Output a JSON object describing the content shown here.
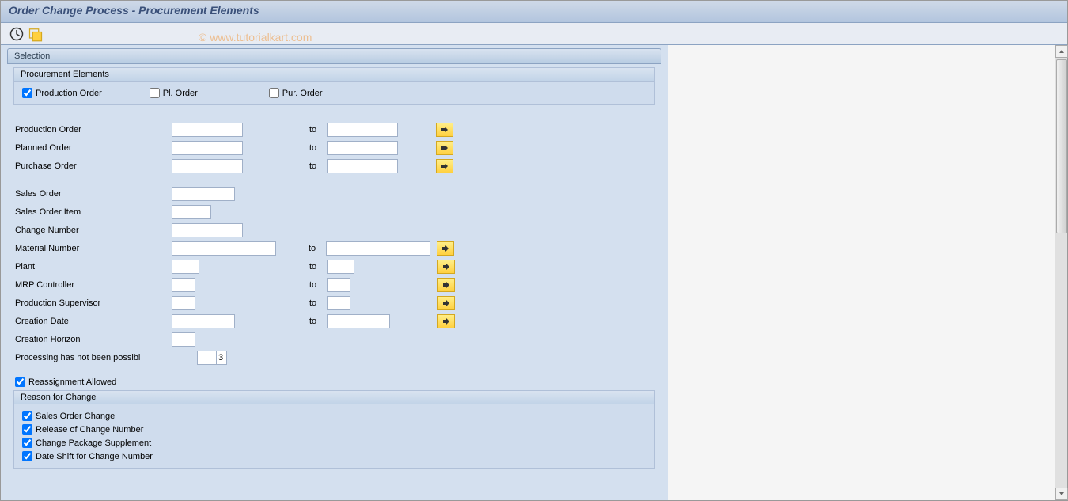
{
  "title": "Order Change Process - Procurement Elements",
  "watermark": "© www.tutorialkart.com",
  "selection": {
    "title": "Selection",
    "procurement": {
      "title": "Procurement Elements",
      "production_order": "Production Order",
      "pl_order": "Pl. Order",
      "pur_order": "Pur. Order"
    },
    "fields": {
      "production_order": "Production Order",
      "planned_order": "Planned Order",
      "purchase_order": "Purchase Order",
      "sales_order": "Sales Order",
      "sales_order_item": "Sales Order Item",
      "change_number": "Change Number",
      "material_number": "Material Number",
      "plant": "Plant",
      "mrp_controller": "MRP Controller",
      "production_supervisor": "Production Supervisor",
      "creation_date": "Creation Date",
      "creation_horizon": "Creation Horizon",
      "processing_not_possible": "Processing has not been possibl",
      "processing_value": "3",
      "to": "to"
    },
    "reassignment": "Reassignment Allowed",
    "reason": {
      "title": "Reason for Change",
      "sales_order_change": "Sales Order Change",
      "release_change_number": "Release of Change Number",
      "change_package_supplement": "Change Package Supplement",
      "date_shift": "Date Shift for Change Number"
    }
  }
}
